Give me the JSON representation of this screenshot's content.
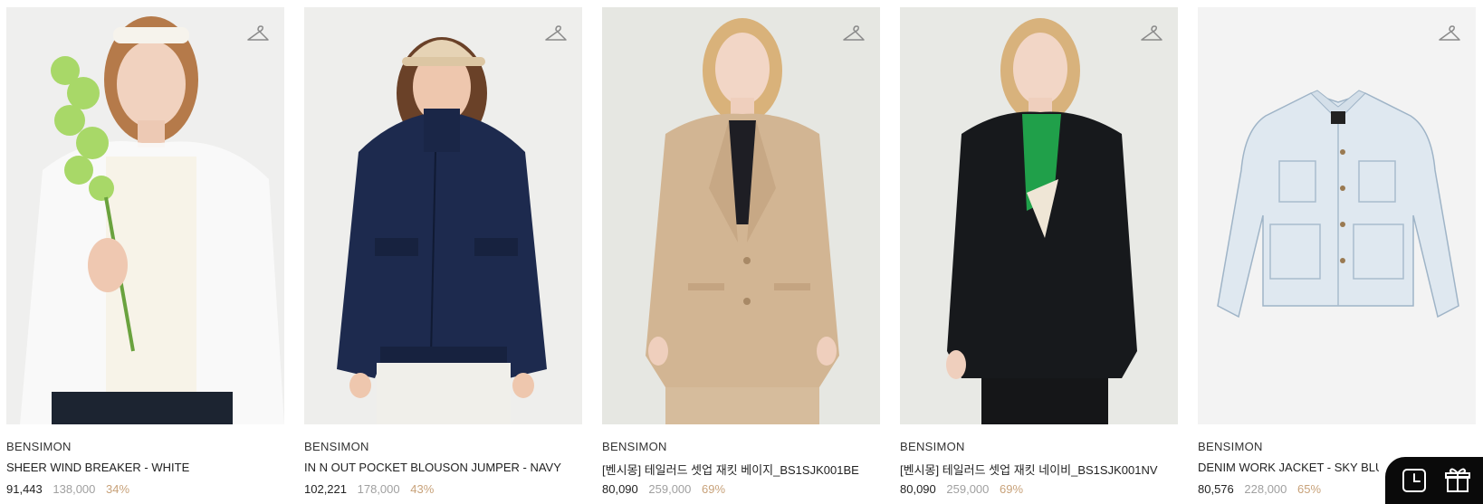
{
  "products": [
    {
      "brand": "BENSIMON",
      "name": "SHEER WIND BREAKER - WHITE",
      "price": "91,443",
      "original_price": "138,000",
      "discount": "34%",
      "image_bg": "#efefee"
    },
    {
      "brand": "BENSIMON",
      "name": "IN N OUT POCKET BLOUSON JUMPER - NAVY",
      "price": "102,221",
      "original_price": "178,000",
      "discount": "43%",
      "image_bg": "#eeeeec"
    },
    {
      "brand": "BENSIMON",
      "name": "[벤시몽] 테일러드 셋업 재킷 베이지_BS1SJK001BE",
      "price": "80,090",
      "original_price": "259,000",
      "discount": "69%",
      "image_bg": "#e6e7e2"
    },
    {
      "brand": "BENSIMON",
      "name": "[벤시몽] 테일러드 셋업 재킷 네이비_BS1SJK001NV",
      "price": "80,090",
      "original_price": "259,000",
      "discount": "69%",
      "image_bg": "#e8e9e5"
    },
    {
      "brand": "BENSIMON",
      "name": "DENIM WORK JACKET - SKY BLUE",
      "price": "80,576",
      "original_price": "228,000",
      "discount": "65%",
      "image_bg": "#f3f3f3"
    }
  ],
  "icons": {
    "wishlist": "hanger-icon",
    "recent": "clock-icon",
    "gift": "gift-icon"
  },
  "colors": {
    "price": "#222222",
    "original_price": "#a0a0a0",
    "discount": "#c8a27a",
    "floating_bar": "#0a0a0a"
  }
}
